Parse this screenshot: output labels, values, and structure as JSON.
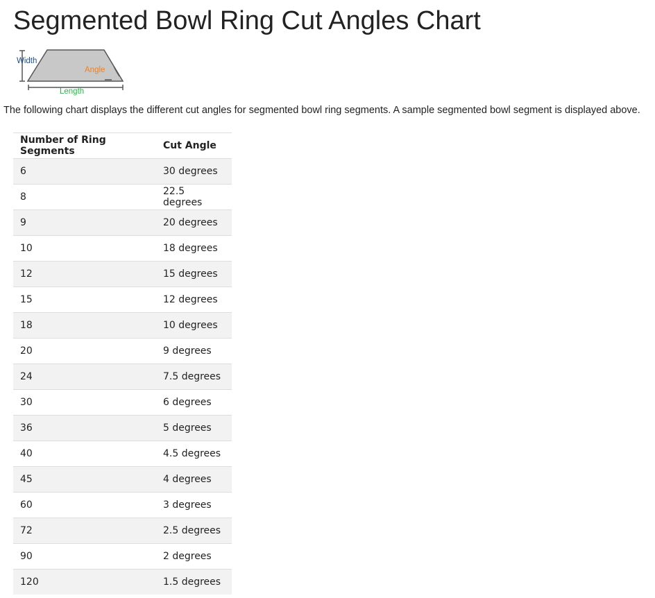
{
  "page": {
    "title": "Segmented Bowl Ring Cut Angles Chart",
    "intro": "The following chart displays the different cut angles for segmented bowl ring segments. A sample segmented bowl segment is displayed above."
  },
  "diagram": {
    "width_label": "Width",
    "angle_label": "Angle",
    "length_label": "Length",
    "colors": {
      "segment_fill": "#c8c8c8",
      "segment_stroke": "#555555",
      "width": "#1d4e89",
      "angle": "#f08020",
      "length": "#22bb44"
    }
  },
  "table": {
    "headers": {
      "segments": "Number of Ring Segments",
      "angle": "Cut Angle"
    },
    "rows": [
      {
        "segments": "6",
        "angle": "30 degrees"
      },
      {
        "segments": "8",
        "angle": "22.5 degrees"
      },
      {
        "segments": "9",
        "angle": "20 degrees"
      },
      {
        "segments": "10",
        "angle": "18 degrees"
      },
      {
        "segments": "12",
        "angle": "15 degrees"
      },
      {
        "segments": "15",
        "angle": "12 degrees"
      },
      {
        "segments": "18",
        "angle": "10 degrees"
      },
      {
        "segments": "20",
        "angle": "9 degrees"
      },
      {
        "segments": "24",
        "angle": "7.5 degrees"
      },
      {
        "segments": "30",
        "angle": "6 degrees"
      },
      {
        "segments": "36",
        "angle": "5 degrees"
      },
      {
        "segments": "40",
        "angle": "4.5 degrees"
      },
      {
        "segments": "45",
        "angle": "4 degrees"
      },
      {
        "segments": "60",
        "angle": "3 degrees"
      },
      {
        "segments": "72",
        "angle": "2.5 degrees"
      },
      {
        "segments": "90",
        "angle": "2 degrees"
      },
      {
        "segments": "120",
        "angle": "1.5 degrees"
      }
    ]
  }
}
